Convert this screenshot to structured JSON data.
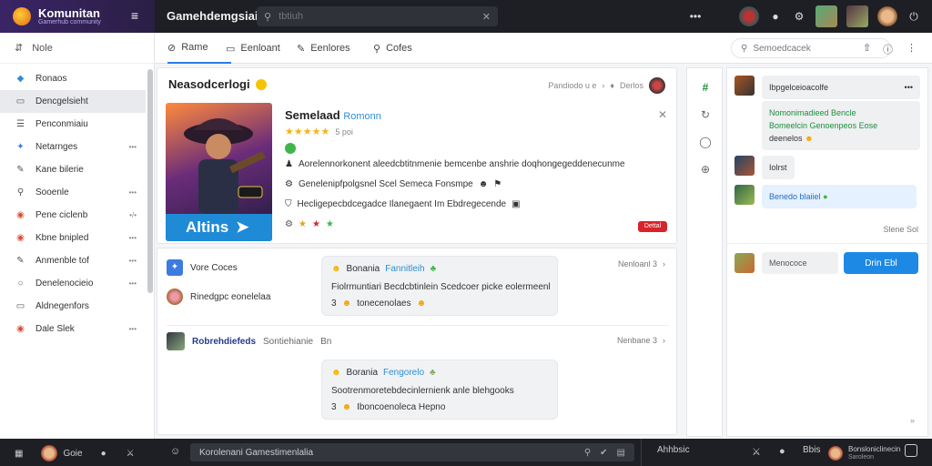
{
  "topbar": {
    "brand": "Komunitan",
    "brand_sub": "Gamerhub community",
    "title": "Gamehdemgsiai",
    "search_placeholder": "tbtiuh",
    "menu_dots": "•••"
  },
  "sidebar": {
    "home": "Nole",
    "items": [
      {
        "label": "Ronaos",
        "icon": "tag-icon",
        "badge": ""
      },
      {
        "label": "Dencgelsieht",
        "icon": "doc-icon",
        "badge": "",
        "active": true
      },
      {
        "label": "Penconmiaiu",
        "icon": "list-icon",
        "badge": ""
      },
      {
        "label": "Netarnges",
        "icon": "app-icon",
        "badge": "•••"
      },
      {
        "label": "Kane bilerie",
        "icon": "edit-icon",
        "badge": ""
      },
      {
        "label": "Sooenle",
        "icon": "search-icon",
        "badge": "•••"
      },
      {
        "label": "Pene ciclenb",
        "icon": "game-icon",
        "badge": "•/•"
      },
      {
        "label": "Kbne bnipled",
        "icon": "game-icon",
        "badge": "•••"
      },
      {
        "label": "Anmenble tof",
        "icon": "edit-icon",
        "badge": "•••"
      },
      {
        "label": "Denelenocieio",
        "icon": "circle-icon",
        "badge": "•••"
      },
      {
        "label": "Aldnegenfors",
        "icon": "doc-icon",
        "badge": ""
      },
      {
        "label": "Dale Slek",
        "icon": "game-icon",
        "badge": "•••"
      }
    ]
  },
  "tabs": [
    {
      "label": "Rame",
      "active": true
    },
    {
      "label": "Eenloant"
    },
    {
      "label": "Eenlores"
    },
    {
      "label": "Cofes"
    }
  ],
  "right_search_placeholder": "Semoedcacek",
  "post": {
    "title": "Neasodcerlogi",
    "meta": "Pandiodo u e",
    "meta2": "Derlos",
    "game_name": "Semelaad",
    "game_sub": "Romonn",
    "rating_text": "5 poi",
    "cover_label": "Altins",
    "lines": [
      "Aorelennorkonent aleedcbtitnmenie bemcenbe anshrie doqhongegeddenecunme",
      "Genelenipfpolgsnel Scel Semeca Fonsmpe",
      "Hecligepecbdcegadce Ilanegaent Im Ebdregecende"
    ],
    "tag": "Dettal"
  },
  "threads": [
    {
      "left1": "Vore Coces",
      "left2": "Rinedgpc eonelelaa",
      "bubble_head": "Bonania",
      "bubble_head_sub": "Fannitleih",
      "bubble_body": "Fiolrmuntiari Becdcbtinlein Scedcoer picke eolermeenl",
      "bubble_count": "3",
      "bubble_foot": "tonecenolaes",
      "right": "Nenloanl 3"
    },
    {
      "left1": "Robrehdiefeds",
      "left1_sub": "Sontiehianie",
      "left1_tail": "Bn",
      "bubble_head": "Borania",
      "bubble_head_sub": "Fengorelo",
      "bubble_body": "Sootrenmoretebdecinlernienk anle blehgooks",
      "bubble_count": "3",
      "bubble_foot": "Iboncoenoleca Hepno",
      "right": "Nenbane 3"
    }
  ],
  "chat": {
    "messages": [
      {
        "title": "Ibpgelceioacolfe",
        "line1": "Nomonimadieed Bencle",
        "line2": "Bomeelcin Genoenpeos Eose",
        "line3": "deenelos",
        "style": "mixed"
      },
      {
        "text": "Iolrst",
        "style": "plain"
      },
      {
        "text": "Benedo blaiiel",
        "style": "blue"
      }
    ],
    "see_more": "Slene Sol",
    "input_value": "Menococe",
    "send_label": "Drin Ebl"
  },
  "bottombar": {
    "left_label": "Goie",
    "input_value": "Korolenani Gamestimenlalia",
    "right_label": "Ahhbsic",
    "right2": "Bbis",
    "profile_label": "Bonsloniclinecin",
    "profile_sub": "Saroleon"
  }
}
